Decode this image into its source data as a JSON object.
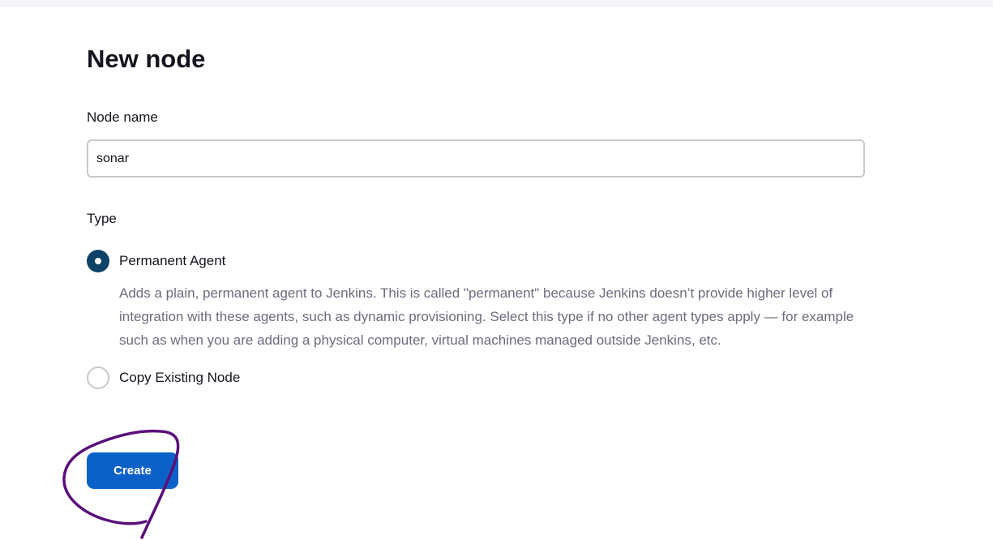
{
  "page": {
    "title": "New node"
  },
  "form": {
    "name_label": "Node name",
    "name_value": "sonar",
    "type_label": "Type",
    "options": [
      {
        "label": "Permanent Agent",
        "selected": true,
        "description": "Adds a plain, permanent agent to Jenkins. This is called \"permanent\" because Jenkins doesn’t provide higher level of integration with these agents, such as dynamic provisioning. Select this type if no other agent types apply — for example such as when you are adding a physical computer, virtual machines managed outside Jenkins, etc."
      },
      {
        "label": "Copy Existing Node",
        "selected": false
      }
    ],
    "create_label": "Create"
  },
  "colors": {
    "primary_button": "#0c61c9",
    "radio_selected": "#0b4266",
    "annotation_stroke": "#5a0f7a"
  }
}
